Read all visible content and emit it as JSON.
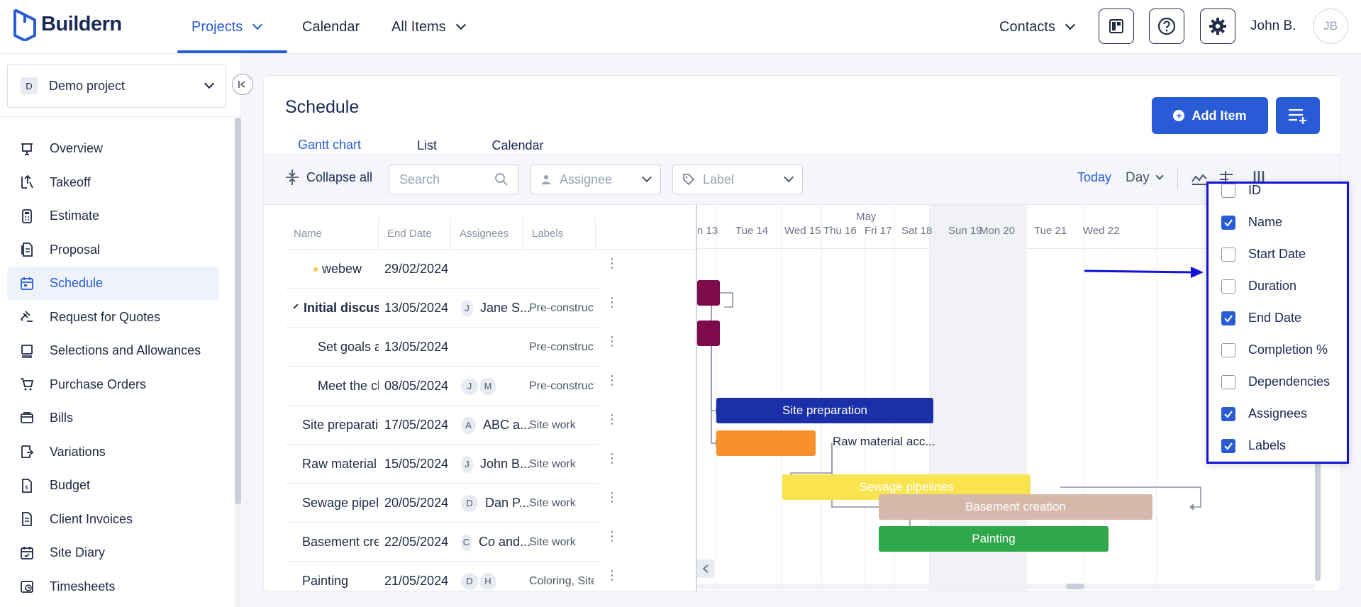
{
  "app": {
    "name": "Buildern"
  },
  "nav": {
    "projects": "Projects",
    "calendar": "Calendar",
    "all_items": "All Items",
    "contacts": "Contacts",
    "user": "John B.",
    "avatar": "JB"
  },
  "sidebar": {
    "project": {
      "badge": "D",
      "name": "Demo project"
    },
    "items": [
      {
        "label": "Overview",
        "icon": "presentation-icon"
      },
      {
        "label": "Takeoff",
        "icon": "takeoff-icon"
      },
      {
        "label": "Estimate",
        "icon": "calculator-icon"
      },
      {
        "label": "Proposal",
        "icon": "proposal-icon"
      },
      {
        "label": "Schedule",
        "icon": "calendar-icon"
      },
      {
        "label": "Request for Quotes",
        "icon": "gavel-icon"
      },
      {
        "label": "Selections and Allowances",
        "icon": "selections-icon"
      },
      {
        "label": "Purchase Orders",
        "icon": "cart-icon"
      },
      {
        "label": "Bills",
        "icon": "bills-icon"
      },
      {
        "label": "Variations",
        "icon": "variations-icon"
      },
      {
        "label": "Budget",
        "icon": "budget-icon"
      },
      {
        "label": "Client Invoices",
        "icon": "invoice-icon"
      },
      {
        "label": "Site Diary",
        "icon": "diary-icon"
      },
      {
        "label": "Timesheets",
        "icon": "timesheet-icon"
      }
    ]
  },
  "schedule": {
    "title": "Schedule",
    "tabs": [
      "Gantt chart",
      "List",
      "Calendar"
    ],
    "add_item": "Add Item",
    "toolbar": {
      "collapse_all": "Collapse all",
      "search_placeholder": "Search",
      "assignee_placeholder": "Assignee",
      "label_placeholder": "Label",
      "today": "Today",
      "view": "Day"
    },
    "columns": [
      "Name",
      "End Date",
      "Assignees",
      "Labels"
    ],
    "rows": [
      {
        "name": "webew",
        "end": "29/02/2024",
        "assignees": [],
        "assignee_name": "",
        "label": "",
        "dot": "#f2c94c"
      },
      {
        "name": "Initial discussi...",
        "end": "13/05/2024",
        "assignees": [
          "J"
        ],
        "assignee_name": "Jane S...",
        "label": "Pre-construct...",
        "dot": ""
      },
      {
        "name": "Set goals a...",
        "end": "13/05/2024",
        "assignees": [],
        "assignee_name": "",
        "label": "Pre-construct...",
        "dot": "#7d0a4a"
      },
      {
        "name": "Meet the cli...",
        "end": "08/05/2024",
        "assignees": [
          "J",
          "M"
        ],
        "assignee_name": "",
        "label": "Pre-construct...",
        "dot": "#7d0a4a"
      },
      {
        "name": "Site preparation",
        "end": "17/05/2024",
        "assignees": [
          "A"
        ],
        "assignee_name": "ABC a...",
        "label": "Site work",
        "dot": ""
      },
      {
        "name": "Raw material ...",
        "end": "15/05/2024",
        "assignees": [
          "J"
        ],
        "assignee_name": "John B...",
        "label": "Site work",
        "dot": ""
      },
      {
        "name": "Sewage pipeli...",
        "end": "20/05/2024",
        "assignees": [
          "D"
        ],
        "assignee_name": "Dan P...",
        "label": "Site work",
        "dot": ""
      },
      {
        "name": "Basement cre...",
        "end": "22/05/2024",
        "assignees": [
          "C"
        ],
        "assignee_name": "Co and...",
        "label": "Site work",
        "dot": ""
      },
      {
        "name": "Painting",
        "end": "21/05/2024",
        "assignees": [
          "D",
          "H"
        ],
        "assignee_name": "",
        "label": "Coloring, Site...",
        "dot": ""
      }
    ],
    "gantt": {
      "month": "May",
      "days": [
        "n 13",
        "Tue 14",
        "Wed 15",
        "Thu 16",
        "Fri 17",
        "Sat 18",
        "Sun 19",
        "Mon 20",
        "Tue 21",
        "Wed 22"
      ],
      "bars": [
        {
          "label": "",
          "color": "#7d0a4a"
        },
        {
          "label": "",
          "color": "#7d0a4a"
        },
        {
          "label": "Site preparation",
          "color": "#1a2fa8"
        },
        {
          "label": "Raw material acc...",
          "color": "#f7902a"
        },
        {
          "label": "Sewage pipelines",
          "color": "#f9e44f"
        },
        {
          "label": "Basement creation",
          "color": "#d4b9ab"
        },
        {
          "label": "Painting",
          "color": "#2ea84a"
        }
      ]
    },
    "columns_popup": [
      {
        "label": "ID",
        "checked": false
      },
      {
        "label": "Name",
        "checked": true
      },
      {
        "label": "Start Date",
        "checked": false
      },
      {
        "label": "Duration",
        "checked": false
      },
      {
        "label": "End Date",
        "checked": true
      },
      {
        "label": "Completion %",
        "checked": false
      },
      {
        "label": "Dependencies",
        "checked": false
      },
      {
        "label": "Assignees",
        "checked": true
      },
      {
        "label": "Labels",
        "checked": true
      }
    ]
  },
  "colors": {
    "accent": "#2a5bd7",
    "annotation": "#1212d8"
  }
}
